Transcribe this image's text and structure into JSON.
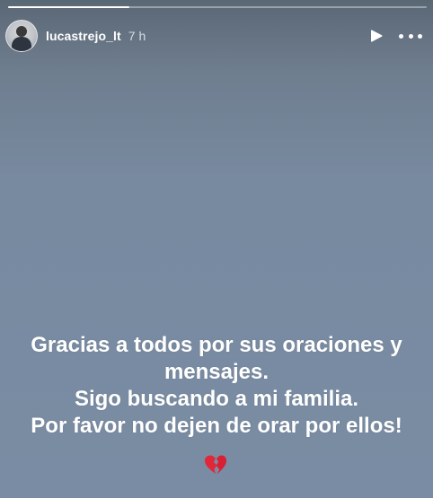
{
  "story": {
    "progress": 0.29,
    "username": "lucastrejo_lt",
    "time": "7 h",
    "caption_lines": [
      "Gracias a todos por sus oraciones y",
      "mensajes.",
      "Sigo buscando a mi familia.",
      "Por favor no dejen de orar por ellos!"
    ],
    "emoji_icon": "broken-heart-icon"
  },
  "colors": {
    "background": "#7a8ca3",
    "text": "#ffffff",
    "heart": "#e0283a"
  }
}
